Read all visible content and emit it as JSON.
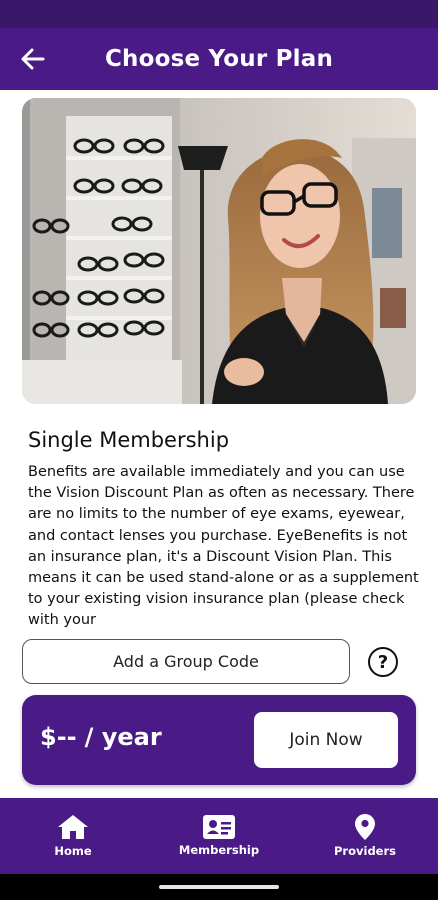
{
  "header": {
    "title": "Choose Your Plan",
    "back_icon": "arrow-left-icon"
  },
  "hero": {
    "image": "woman-wearing-glasses-in-optical-store-photo"
  },
  "plan": {
    "title": "Single Membership",
    "description": "Benefits are available immediately and you can use the Vision Discount Plan as often as necessary. There are no limits to the number of eye exams, eyewear, and contact lenses you purchase. EyeBenefits is not an insurance plan, it's a Discount Vision Plan. This means it can be used stand-alone or as a supplement to your existing vision insurance plan (please check with your"
  },
  "group_code": {
    "button_label": "Add a Group Code",
    "help_icon": "question-circle-icon",
    "help_glyph": "?"
  },
  "pricing": {
    "price": "$--",
    "period": "/ year",
    "join_label": "Join Now"
  },
  "bottom_nav": {
    "items": [
      {
        "label": "Home",
        "icon": "home-icon"
      },
      {
        "label": "Membership",
        "icon": "id-card-icon"
      },
      {
        "label": "Providers",
        "icon": "location-pin-icon"
      }
    ]
  },
  "colors": {
    "brand_purple": "#4a1a86",
    "status_bar": "#3a1769",
    "background": "#ffffff"
  }
}
